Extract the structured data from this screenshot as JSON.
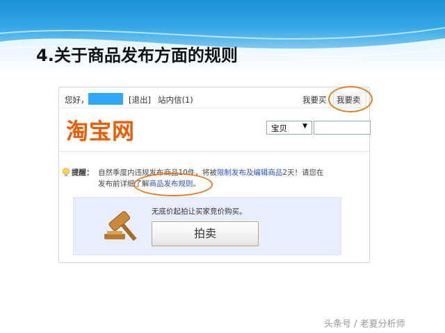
{
  "slide": {
    "title": "4.关于商品发布方面的规则"
  },
  "taobao": {
    "topbar": {
      "greeting": "您好，",
      "logout": "[退出]",
      "inbox": "站内信(1)",
      "buy": "我要买",
      "sell": "我要卖"
    },
    "logo": "淘宝网",
    "search": {
      "category": "宝贝",
      "query": ""
    },
    "notice": {
      "label": "提醒：",
      "line1_prefix": "自然季度内违规发布商品10件，将被",
      "line1_link": "限制发布及编辑商品",
      "line1_suffix": "2天！请您在",
      "line2_prefix": "发布前详细了解",
      "line2_link": "商品发布规则",
      "line2_suffix": "。"
    },
    "auction": {
      "description": "无底价起拍让买家竞价购买。",
      "button": "拍卖"
    }
  },
  "watermark": "头条号 / 老夏分析师",
  "colors": {
    "header_blue": "#1a8fd6",
    "logo_orange": "#f05a00",
    "annotation_orange": "#e97a1c",
    "link_blue": "#2a4fc7",
    "user_mask": "#2ea7ff"
  }
}
